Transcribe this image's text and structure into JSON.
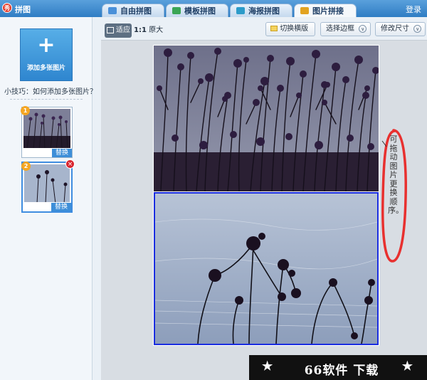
{
  "app": {
    "title": "拼图",
    "logo_text": "秀",
    "login": "登录"
  },
  "tabs": [
    {
      "label": "自由拼图",
      "icon": "free-collage-icon",
      "color": "#4a90d9"
    },
    {
      "label": "模板拼图",
      "icon": "template-collage-icon",
      "color": "#3aa655"
    },
    {
      "label": "海报拼图",
      "icon": "poster-collage-icon",
      "color": "#2c9bc9"
    },
    {
      "label": "图片拼接",
      "icon": "image-stitch-icon",
      "color": "#e2a321",
      "active": true
    }
  ],
  "sidebar": {
    "add_button": {
      "plus": "+",
      "label": "添加多张图片"
    },
    "tip": "小技巧：如何添加多张图片？",
    "thumbnails": [
      {
        "badge": "1",
        "replace": "替换"
      },
      {
        "badge": "2",
        "replace": "替换",
        "remove": "×"
      }
    ]
  },
  "toolbar": {
    "fit": "适应",
    "actual_prefix": "1:1",
    "actual": "原大",
    "switch_orientation": "切换横版",
    "select_border": "选择边框",
    "resize": "修改尺寸"
  },
  "annotation": "可拖动图片更换顺序。",
  "watermark": {
    "star": "★",
    "text": "66软件 下载"
  },
  "colors": {
    "accent": "#2f7dc4",
    "selection_border": "#1a2de0",
    "annotation_circle": "#e8302f"
  }
}
